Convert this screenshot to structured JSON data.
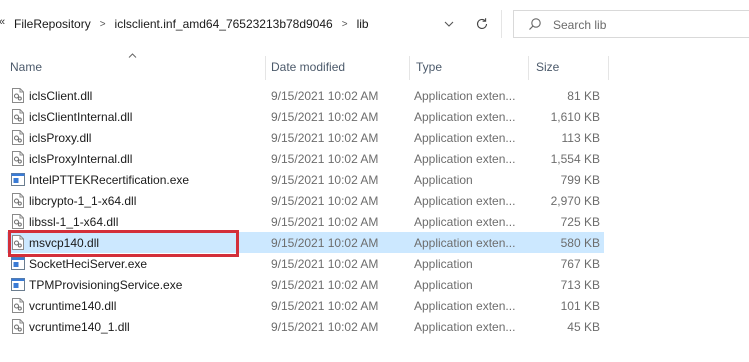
{
  "address_bar": {
    "breadcrumbs": [
      "FileRepository",
      "iclsclient.inf_amd64_76523213b78d9046",
      "lib"
    ],
    "search_placeholder": "Search lib"
  },
  "columns": {
    "name": "Name",
    "date": "Date modified",
    "type": "Type",
    "size": "Size"
  },
  "files": [
    {
      "name": "iclsClient.dll",
      "date": "9/15/2021 10:02 AM",
      "type": "Application exten...",
      "size": "81 KB",
      "icon": "dll-file-icon"
    },
    {
      "name": "iclsClientInternal.dll",
      "date": "9/15/2021 10:02 AM",
      "type": "Application exten...",
      "size": "1,610 KB",
      "icon": "dll-file-icon"
    },
    {
      "name": "iclsProxy.dll",
      "date": "9/15/2021 10:02 AM",
      "type": "Application exten...",
      "size": "113 KB",
      "icon": "dll-file-icon"
    },
    {
      "name": "iclsProxyInternal.dll",
      "date": "9/15/2021 10:02 AM",
      "type": "Application exten...",
      "size": "1,554 KB",
      "icon": "dll-file-icon"
    },
    {
      "name": "IntelPTTEKRecertification.exe",
      "date": "9/15/2021 10:02 AM",
      "type": "Application",
      "size": "799 KB",
      "icon": "exe-file-icon"
    },
    {
      "name": "libcrypto-1_1-x64.dll",
      "date": "9/15/2021 10:02 AM",
      "type": "Application exten...",
      "size": "2,970 KB",
      "icon": "dll-file-icon"
    },
    {
      "name": "libssl-1_1-x64.dll",
      "date": "9/15/2021 10:02 AM",
      "type": "Application exten...",
      "size": "725 KB",
      "icon": "dll-file-icon"
    },
    {
      "name": "msvcp140.dll",
      "date": "9/15/2021 10:02 AM",
      "type": "Application exten...",
      "size": "580 KB",
      "icon": "dll-file-icon",
      "selected": true
    },
    {
      "name": "SocketHeciServer.exe",
      "date": "9/15/2021 10:02 AM",
      "type": "Application",
      "size": "767 KB",
      "icon": "exe-file-icon"
    },
    {
      "name": "TPMProvisioningService.exe",
      "date": "9/15/2021 10:02 AM",
      "type": "Application",
      "size": "713 KB",
      "icon": "exe-file-icon"
    },
    {
      "name": "vcruntime140.dll",
      "date": "9/15/2021 10:02 AM",
      "type": "Application exten...",
      "size": "101 KB",
      "icon": "dll-file-icon"
    },
    {
      "name": "vcruntime140_1.dll",
      "date": "9/15/2021 10:02 AM",
      "type": "Application exten...",
      "size": "45 KB",
      "icon": "dll-file-icon"
    }
  ],
  "colors": {
    "selected_row": "#cce8ff",
    "highlight_box": "#d32f3a",
    "header_text": "#4c5a6b"
  }
}
